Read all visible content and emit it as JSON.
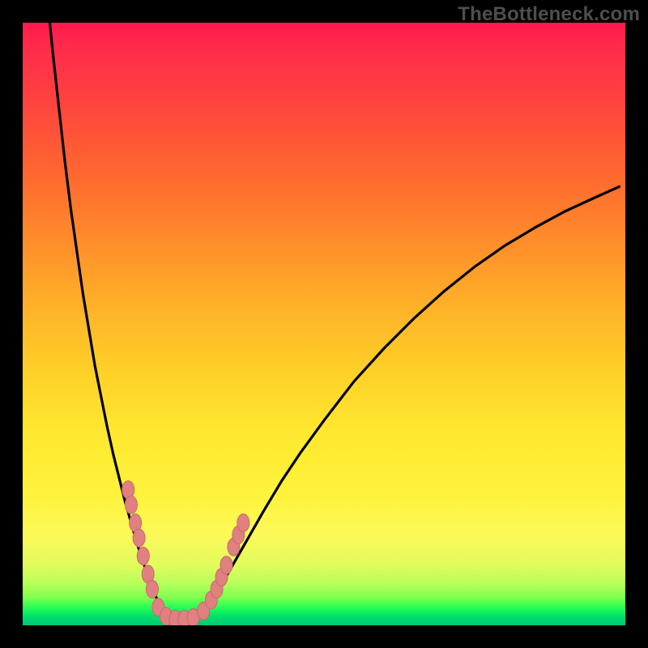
{
  "watermark": "TheBottleneck.com",
  "colors": {
    "frame": "#000000",
    "curve": "#000000",
    "dot_fill": "#e08080",
    "dot_stroke": "#c86a6a",
    "gradient_top": "#ff1a4d",
    "gradient_bottom": "#00c874"
  },
  "chart_data": {
    "type": "line",
    "title": "",
    "xlabel": "",
    "ylabel": "",
    "xlim": [
      0,
      100
    ],
    "ylim": [
      0,
      100
    ],
    "grid": false,
    "legend": false,
    "note": "Axes unlabeled in source image; values are estimated positions within plot area on a 0–100 scale (0,0 = bottom-left).",
    "series": [
      {
        "name": "left-branch",
        "x": [
          4.5,
          5,
          6,
          7,
          8,
          9,
          10,
          11,
          12,
          13,
          14,
          15,
          16,
          17,
          18,
          19,
          20,
          21,
          22,
          23
        ],
        "y": [
          100,
          95,
          86,
          77,
          69,
          62,
          55,
          49,
          43,
          38,
          33,
          28.5,
          24.5,
          20.5,
          17,
          13.5,
          10.5,
          7.5,
          5,
          2.7
        ]
      },
      {
        "name": "valley-floor",
        "x": [
          23,
          24,
          25,
          26,
          27,
          28,
          29,
          30
        ],
        "y": [
          2.7,
          1.6,
          1.0,
          0.8,
          0.8,
          1.0,
          1.4,
          2.2
        ]
      },
      {
        "name": "right-branch",
        "x": [
          30,
          32,
          34,
          36,
          38,
          40,
          43,
          46,
          50,
          55,
          60,
          65,
          70,
          75,
          80,
          85,
          90,
          95,
          99
        ],
        "y": [
          2.2,
          5,
          8.5,
          12,
          15.5,
          19,
          24,
          28.5,
          34,
          40.5,
          46,
          51,
          55.5,
          59.5,
          63,
          66,
          68.7,
          71,
          72.8
        ]
      }
    ],
    "dots": {
      "name": "highlighted-points",
      "note": "Pink capsule-shaped markers clustered near the valley; (x,y) on same 0–100 scale.",
      "points": [
        [
          17.5,
          22.5
        ],
        [
          18.0,
          20.0
        ],
        [
          18.7,
          17.0
        ],
        [
          19.3,
          14.5
        ],
        [
          20.0,
          11.5
        ],
        [
          20.8,
          8.5
        ],
        [
          21.5,
          6.0
        ],
        [
          22.5,
          3.0
        ],
        [
          23.8,
          1.5
        ],
        [
          25.3,
          1.0
        ],
        [
          26.8,
          1.0
        ],
        [
          28.3,
          1.3
        ],
        [
          30.0,
          2.4
        ],
        [
          31.3,
          4.2
        ],
        [
          32.2,
          6.0
        ],
        [
          33.0,
          8.0
        ],
        [
          33.8,
          10.0
        ],
        [
          35.0,
          13.0
        ],
        [
          35.8,
          15.0
        ],
        [
          36.6,
          17.0
        ]
      ]
    }
  }
}
